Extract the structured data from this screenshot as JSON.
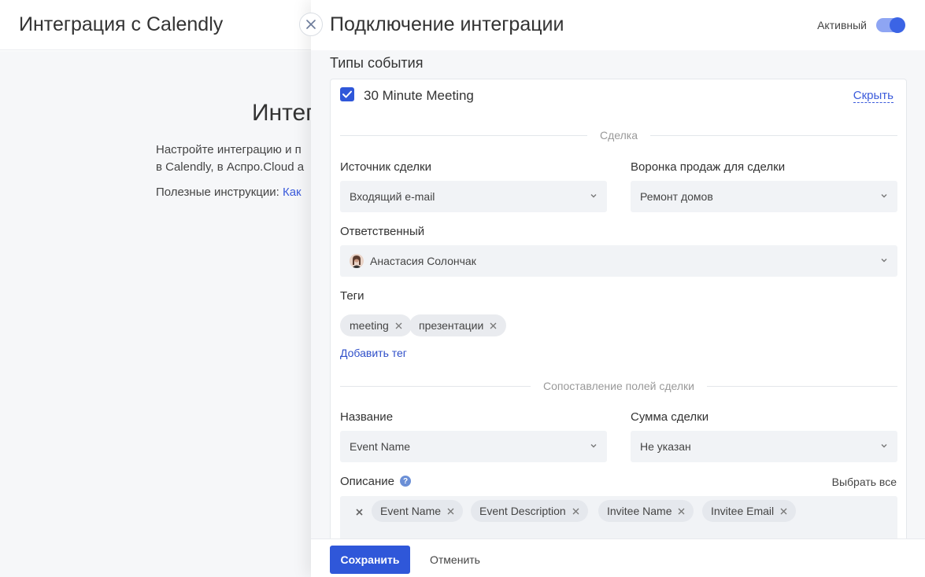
{
  "background": {
    "title": "Интеграция с Calendly",
    "heading": "Интег",
    "text_line1": "Настройте интеграцию и п",
    "text_line2": "в Calendly, в Аспро.Cloud а",
    "instructions_label": "Полезные инструкции: ",
    "instructions_link": "Как"
  },
  "panel": {
    "title": "Подключение интеграции",
    "status_label": "Активный",
    "toggle_on": true,
    "section_title": "Типы события"
  },
  "event": {
    "name": "30 Minute Meeting",
    "checked": true,
    "hide_label": "Скрыть",
    "deal_divider": "Сделка",
    "source_label": "Источник сделки",
    "source_value": "Входящий e-mail",
    "funnel_label": "Воронка продаж для сделки",
    "funnel_value": "Ремонт домов",
    "responsible_label": "Ответственный",
    "responsible_value": "Анастасия Солончак",
    "tags_label": "Теги",
    "tags": [
      "meeting",
      "презентации"
    ],
    "add_tag": "Добавить тег",
    "mapping_divider": "Сопоставление полей сделки",
    "name_label": "Название",
    "name_value": "Event Name",
    "amount_label": "Сумма сделки",
    "amount_value": "Не указан",
    "description_label": "Описание",
    "select_all": "Выбрать все",
    "description_tags": [
      "Event Name",
      "Event Description",
      "Invitee Name",
      "Invitee Email"
    ]
  },
  "footer": {
    "save": "Сохранить",
    "cancel": "Отменить"
  },
  "colors": {
    "accent": "#2f57d9",
    "link": "#3b5bdb"
  }
}
